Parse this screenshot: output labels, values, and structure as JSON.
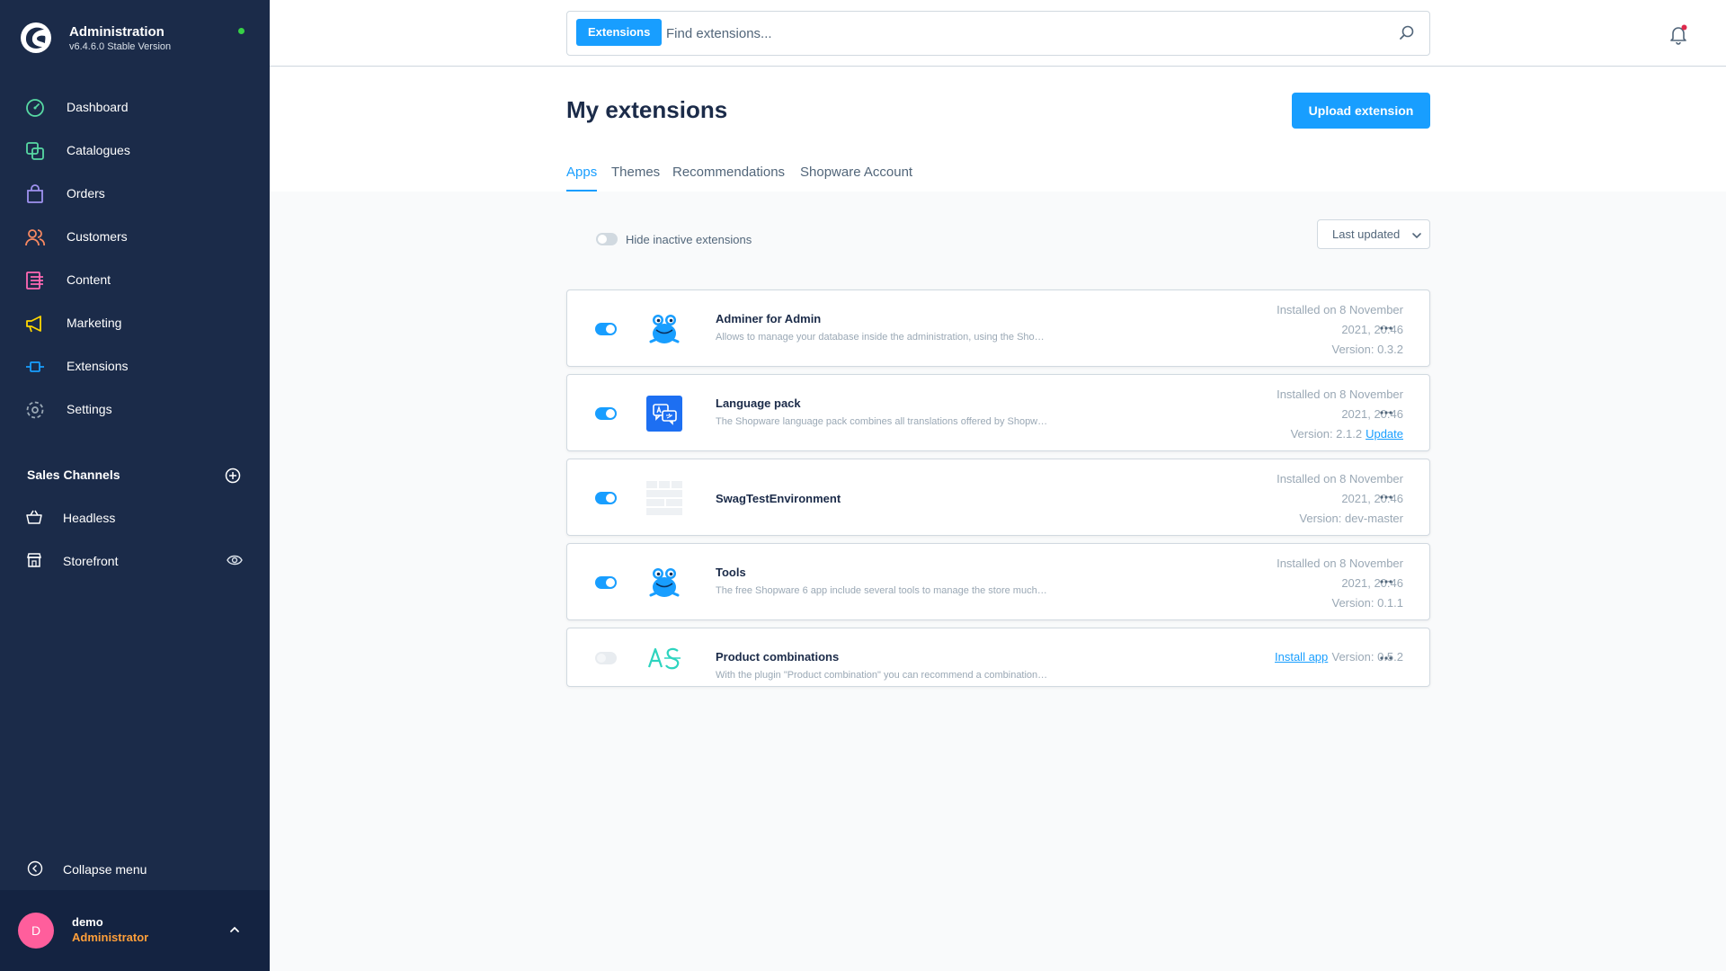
{
  "sidebar": {
    "brand_title": "Administration",
    "brand_version": "v6.4.6.0 Stable Version",
    "nav": [
      {
        "label": "Dashboard",
        "icon": "dashboard-icon",
        "color": "#57d9a3"
      },
      {
        "label": "Catalogues",
        "icon": "catalogue-icon",
        "color": "#57d9a3"
      },
      {
        "label": "Orders",
        "icon": "orders-icon",
        "color": "#a092f0"
      },
      {
        "label": "Customers",
        "icon": "customers-icon",
        "color": "#f88962"
      },
      {
        "label": "Content",
        "icon": "content-icon",
        "color": "#ff68b4"
      },
      {
        "label": "Marketing",
        "icon": "marketing-icon",
        "color": "#ffd700"
      },
      {
        "label": "Extensions",
        "icon": "extensions-icon",
        "color": "#189eff"
      },
      {
        "label": "Settings",
        "icon": "settings-icon",
        "color": "#9aa8b5"
      }
    ],
    "sales_channels_title": "Sales Channels",
    "sales_channels": [
      {
        "label": "Headless"
      },
      {
        "label": "Storefront"
      }
    ],
    "collapse_label": "Collapse menu",
    "user": {
      "initial": "D",
      "name": "demo",
      "role": "Administrator"
    }
  },
  "search": {
    "tag": "Extensions",
    "placeholder": "Find extensions..."
  },
  "page": {
    "title": "My extensions",
    "upload_label": "Upload extension",
    "tabs": [
      "Apps",
      "Themes",
      "Recommendations",
      "Shopware Account"
    ],
    "active_tab": "Apps"
  },
  "filters": {
    "hide_inactive_label": "Hide inactive extensions",
    "sort_label": "Last updated"
  },
  "extensions": [
    {
      "name": "Adminer for Admin",
      "description": "Allows to manage your database inside the administration, using the Shopware Adminer plugin",
      "installed_line1": "Installed on 8 November",
      "installed_line2": "2021, 20:46",
      "version": "Version: 0.3.2",
      "active": true,
      "icon": "frog-icon"
    },
    {
      "name": "Language pack",
      "description": "The Shopware language pack combines all translations offered by Shopware",
      "installed_line1": "Installed on 8 November",
      "installed_line2": "2021, 20:46",
      "version": "Version: 2.1.2",
      "update_label": "Update",
      "active": true,
      "icon": "language-pack-icon"
    },
    {
      "name": "SwagTestEnvironment",
      "description": "",
      "installed_line1": "Installed on 8 November",
      "installed_line2": "2021, 20:46",
      "version": "Version: dev-master",
      "active": true,
      "icon": "placeholder-icon"
    },
    {
      "name": "Tools",
      "description": "The free Shopware 6 app include several tools to manage the store much easier",
      "installed_line1": "Installed on 8 November",
      "installed_line2": "2021, 20:46",
      "version": "Version: 0.1.1",
      "active": true,
      "icon": "frog-icon"
    },
    {
      "name": "Product combinations",
      "description": "With the plugin \"Product combination\" you can recommend a combination of products",
      "version": "Version: 0.5.2",
      "install_label": "Install app",
      "active": false,
      "icon": "product-combinations-logo"
    }
  ]
}
